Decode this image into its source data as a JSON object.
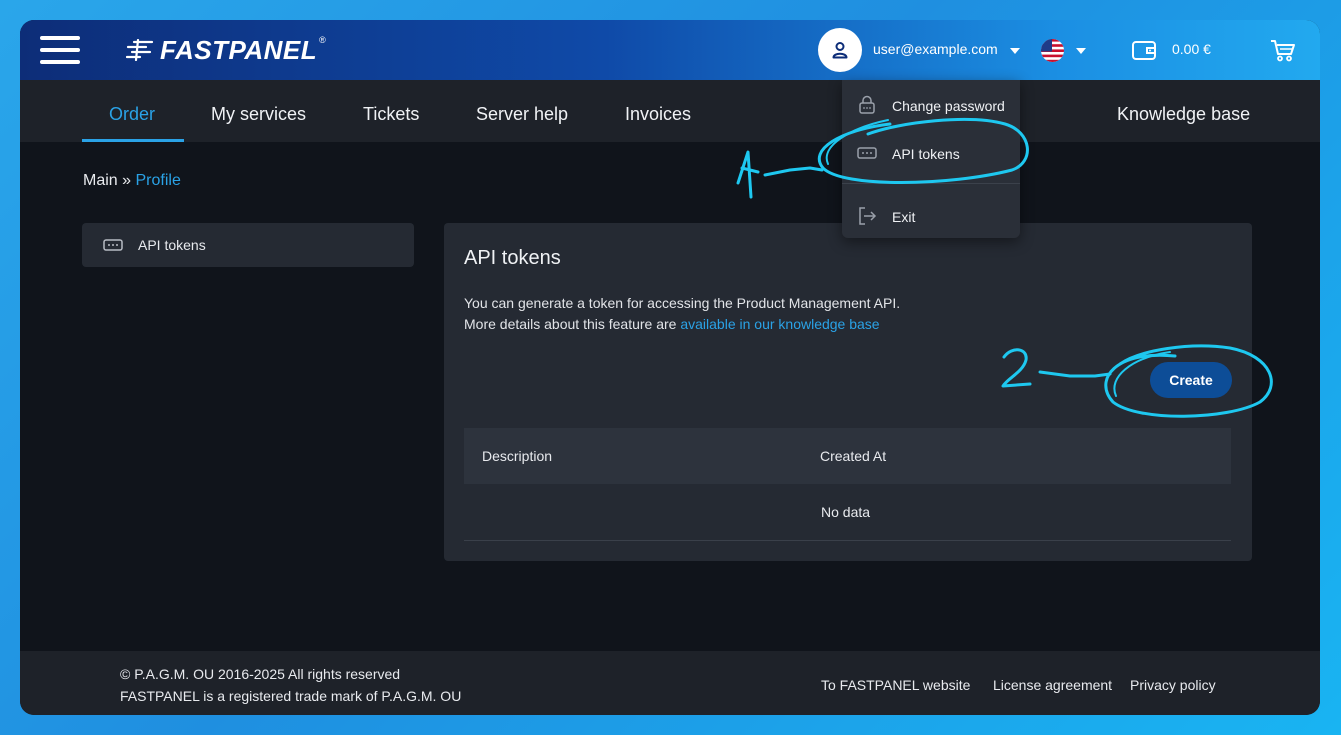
{
  "header": {
    "logo_text": "FASTPANEL",
    "logo_reg": "®",
    "user_email": "user@example.com",
    "balance": "0.00 €"
  },
  "nav": {
    "items": [
      "Order",
      "My services",
      "Tickets",
      "Server help",
      "Invoices"
    ],
    "right_item": "Knowledge base",
    "active": "Order"
  },
  "user_menu": {
    "items": [
      "Change password",
      "API tokens",
      "Exit"
    ]
  },
  "breadcrumb": {
    "root": "Main",
    "separator": " » ",
    "current": "Profile"
  },
  "sidebar": {
    "items": [
      {
        "label": "API tokens"
      }
    ]
  },
  "panel": {
    "title": "API tokens",
    "description_line1": "You can generate a token for accessing the Product Management API.",
    "description_line2_prefix": "More details about this feature are ",
    "description_link": "available in our knowledge base",
    "create_label": "Create",
    "table": {
      "columns": [
        "Description",
        "Created At"
      ],
      "empty_text": "No data"
    }
  },
  "footer": {
    "copyright": "© P.A.G.M. OU 2016-2025 All rights reserved",
    "trademark": "FASTPANEL is a registered trade mark of P.A.G.M. OU",
    "links": [
      "To FASTPANEL website",
      "License agreement",
      "Privacy policy"
    ]
  },
  "colors": {
    "accent": "#2aa2e6",
    "annotation": "#1ec8f0",
    "create_button": "#0d4d97"
  }
}
